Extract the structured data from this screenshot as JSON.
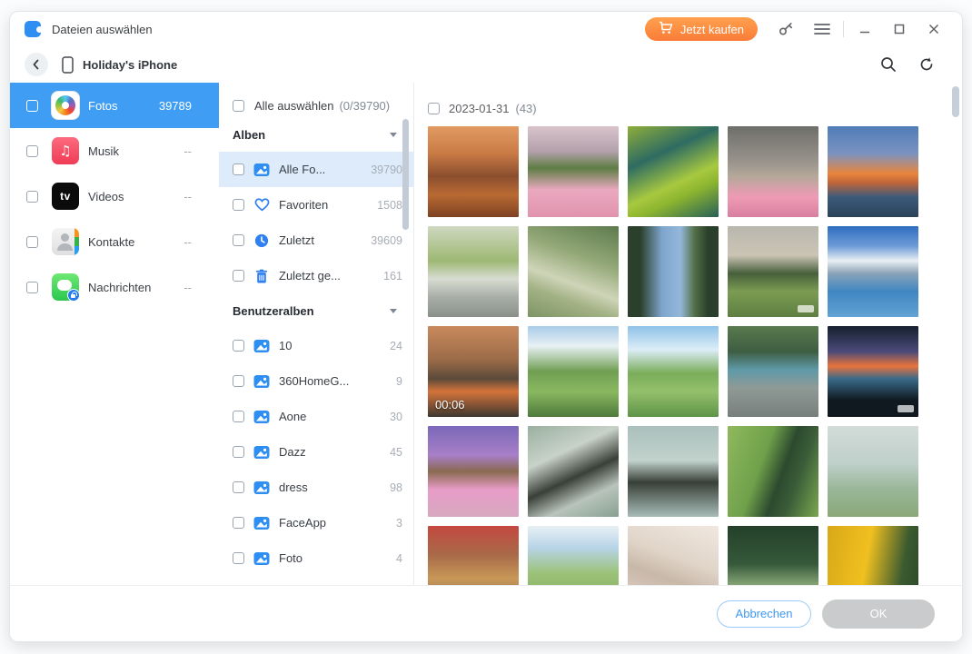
{
  "window": {
    "title": "Dateien auswählen",
    "buy_button": "Jetzt kaufen",
    "device_name": "Holiday's iPhone"
  },
  "colors": {
    "accent_blue": "#3f9ef4",
    "buy_orange": "#fa7c38",
    "highlight_row": "#ddebfb",
    "ok_disabled_gray": "#c9cbcd"
  },
  "sidebar": {
    "items": [
      {
        "label": "Fotos",
        "count": "39789",
        "icon": "photos-app",
        "selected": true
      },
      {
        "label": "Musik",
        "count": "--",
        "icon": "music-app",
        "selected": false
      },
      {
        "label": "Videos",
        "count": "--",
        "icon": "videos-app",
        "selected": false
      },
      {
        "label": "Kontakte",
        "count": "--",
        "icon": "contacts-app",
        "selected": false
      },
      {
        "label": "Nachrichten",
        "count": "--",
        "icon": "messages-app",
        "selected": false
      }
    ]
  },
  "albums_panel": {
    "select_all_label": "Alle auswählen",
    "select_all_count": "(0/39790)",
    "sections": [
      {
        "title": "Alben",
        "items": [
          {
            "label": "Alle Fo...",
            "count": "39790",
            "icon": "album",
            "highlighted": true
          },
          {
            "label": "Favoriten",
            "count": "1508",
            "icon": "heart",
            "highlighted": false
          },
          {
            "label": "Zuletzt",
            "count": "39609",
            "icon": "clock",
            "highlighted": false
          },
          {
            "label": "Zuletzt ge...",
            "count": "161",
            "icon": "trash",
            "highlighted": false
          }
        ]
      },
      {
        "title": "Benutzeralben",
        "items": [
          {
            "label": "10",
            "count": "24",
            "icon": "album",
            "highlighted": false
          },
          {
            "label": "360HomeG...",
            "count": "9",
            "icon": "album",
            "highlighted": false
          },
          {
            "label": "Aone",
            "count": "30",
            "icon": "album",
            "highlighted": false
          },
          {
            "label": "Dazz",
            "count": "45",
            "icon": "album",
            "highlighted": false
          },
          {
            "label": "dress",
            "count": "98",
            "icon": "album",
            "highlighted": false
          },
          {
            "label": "FaceApp",
            "count": "3",
            "icon": "album",
            "highlighted": false
          },
          {
            "label": "Foto",
            "count": "4",
            "icon": "album",
            "highlighted": false
          }
        ]
      }
    ]
  },
  "photo_panel": {
    "date_label": "2023-01-31",
    "date_count": "(43)",
    "photos": [
      {
        "name": "harbor-sunset-lamp",
        "gradient": "linear-gradient(180deg,#e29a62 0%,#c97a45 30%,#8a4e2e 55%,#b96a33 75%,#7e4222 100%)"
      },
      {
        "name": "tulip-field-blossoms",
        "gradient": "linear-gradient(180deg,#d9c4cc 0%,#b2a0aa 28%,#5e7d44 46%,#eaa9c0 70%,#e193ae 100%)"
      },
      {
        "name": "lotus-leaves-pond",
        "gradient": "linear-gradient(155deg,#8fae3a 0%,#2e6b62 32%,#a7c93f 60%,#8db52f 72%,#276058 100%)"
      },
      {
        "name": "city-street-tulips",
        "gradient": "linear-gradient(180deg,#6e6f6a 0%,#9a948c 40%,#b5a89a 55%,#ef9ab5 78%,#d97fa0 100%)"
      },
      {
        "name": "ocean-sunset-clouds",
        "gradient": "linear-gradient(180deg,#4f7cb8 0%,#7a93c0 30%,#e8853c 52%,#c2663a 62%,#3c5a7a 78%,#2c4258 100%)"
      },
      {
        "name": "bus-interior",
        "gradient": "linear-gradient(180deg,#cfd8c0 0%,#9db873 38%,#d8dcd2 58%,#a9afa8 78%,#8a8f8a 100%)"
      },
      {
        "name": "forest-light-rays",
        "gradient": "linear-gradient(200deg,#5d7a4d 0%,#93a877 35%,#cfd4b8 60%,#a3b285 75%,#7d9465 100%)"
      },
      {
        "name": "trees-framing-sky",
        "gradient": "linear-gradient(90deg,#2b402c 14%,#7fa6cd 38%,#93b7da 58%,#526e45 74%,#2b402c 88%)"
      },
      {
        "name": "lone-tree-meadow",
        "gradient": "linear-gradient(180deg,#b8b7ae 0%,#cbc4b4 32%,#47603c 52%,#7c9c53 72%,#5d7f41 100%)",
        "watermark": true
      },
      {
        "name": "mountain-lake",
        "gradient": "linear-gradient(180deg,#2e6ec0 0%,#6f9bd8 22%,#e9eff3 38%,#8aa3b8 52%,#3f86c2 72%,#63a2d4 100%)"
      },
      {
        "name": "sunset-village-video",
        "gradient": "linear-gradient(180deg,#c98a5c 0%,#9a6a48 38%,#5a4a3a 58%,#d4733a 72%,#3e3830 100%)",
        "duration": "00:06"
      },
      {
        "name": "alpine-chalet-meadow",
        "gradient": "linear-gradient(180deg,#a9cce8 0%,#e8f0f4 22%,#6f9e52 50%,#8ab860 72%,#4e7a3c 100%)"
      },
      {
        "name": "alpine-valley",
        "gradient": "linear-gradient(180deg,#8fc2e8 0%,#dcedf7 26%,#79ad5a 52%,#94c06b 72%,#5e9448 100%)"
      },
      {
        "name": "street-to-sea",
        "gradient": "linear-gradient(180deg,#5a7a4e 0%,#3e5e42 28%,#5e9aa8 48%,#8f9a96 68%,#777f7b 100%)"
      },
      {
        "name": "car-window-palms",
        "gradient": "linear-gradient(180deg,#15202e 0%,#4a4a7a 28%,#e8743c 44%,#3a6a8a 58%,#101820 82%)",
        "watermark": true
      },
      {
        "name": "branch-purple-sky",
        "gradient": "linear-gradient(180deg,#7a68b8 0%,#a87fc8 32%,#8a6a50 50%,#e89cc8 70%,#d8a8c0 100%)"
      },
      {
        "name": "black-swan-flowers",
        "gradient": "linear-gradient(155deg,#9ab0a0 0%,#c8d2c8 32%,#3a4038 55%,#b8c4bc 75%,#88a090 100%)"
      },
      {
        "name": "swan-and-bird",
        "gradient": "linear-gradient(180deg,#aac0bc 0%,#c2d2cc 38%,#384038 62%,#a8bcb8 100%)"
      },
      {
        "name": "hillside-evergreens",
        "gradient": "linear-gradient(110deg,#8fb95e 0%,#6fa04a 38%,#2c4a2e 58%,#3a5c38 72%,#7aa850 100%)"
      },
      {
        "name": "pale-field-house",
        "gradient": "linear-gradient(180deg,#d2dcd8 0%,#bfcfc9 42%,#9ab89a 68%,#8aa878 100%)"
      },
      {
        "name": "market-red-awning",
        "gradient": "linear-gradient(180deg,#c44840 0%,#a86a48 32%,#c89858 58%,#6a5a48 100%)"
      },
      {
        "name": "green-tree-sky",
        "gradient": "linear-gradient(180deg,#e8f0f4 0%,#b8d4e8 24%,#9cc278 52%,#7aa858 100%)"
      },
      {
        "name": "cherry-blossoms",
        "gradient": "linear-gradient(200deg,#f0e8e0 0%,#e0d4c8 38%,#c8b8a8 58%,#ead8d0 100%)"
      },
      {
        "name": "forest-path",
        "gradient": "linear-gradient(180deg,#24402a 0%,#35593a 42%,#8aa878 66%,#2c4830 100%)"
      },
      {
        "name": "yellow-autumn-tree",
        "gradient": "linear-gradient(100deg,#d8a818 0%,#f0c020 42%,#3a5a30 78%,#2c4828 100%)"
      }
    ]
  },
  "footer": {
    "cancel_label": "Abbrechen",
    "ok_label": "OK"
  }
}
